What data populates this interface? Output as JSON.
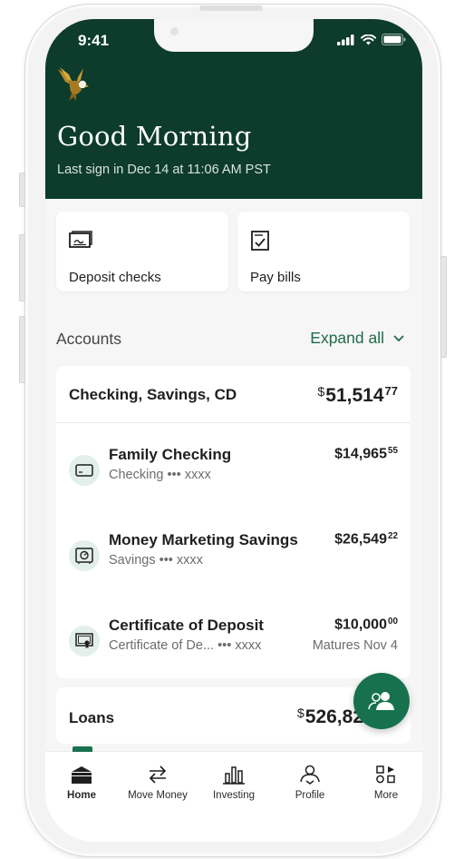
{
  "status_bar": {
    "time": "9:41"
  },
  "header": {
    "greeting": "Good Morning",
    "last_sign_in": "Last sign in Dec 14 at 11:06 AM PST"
  },
  "quick_actions": [
    {
      "label": "Deposit checks",
      "icon": "check-deposit-icon"
    },
    {
      "label": "Pay bills",
      "icon": "bill-icon"
    }
  ],
  "accounts_section": {
    "title": "Accounts",
    "expand_label": "Expand all"
  },
  "account_group": {
    "title": "Checking, Savings, CD",
    "total_whole": "51,514",
    "total_cents": "77",
    "accounts": [
      {
        "name": "Family Checking",
        "subtitle": "Checking ••• xxxx",
        "amount_whole": "$14,965",
        "amount_cents": "55",
        "right_note": "",
        "icon": "card-icon"
      },
      {
        "name": "Money Marketing Savings",
        "subtitle": "Savings ••• xxxx",
        "amount_whole": "$26,549",
        "amount_cents": "22",
        "right_note": "",
        "icon": "safe-icon"
      },
      {
        "name": "Certificate of Deposit",
        "subtitle": "Certificate of De... ••• xxxx",
        "amount_whole": "$10,000",
        "amount_cents": "00",
        "right_note": "Matures Nov 4",
        "icon": "certificate-icon"
      }
    ]
  },
  "loans": {
    "title": "Loans",
    "amount_whole": "526,82"
  },
  "currency_symbol": "$",
  "bottom_nav": [
    {
      "label": "Home",
      "icon": "home-icon",
      "active": true
    },
    {
      "label": "Move Money",
      "icon": "transfer-icon",
      "active": false
    },
    {
      "label": "Investing",
      "icon": "bar-chart-icon",
      "active": false
    },
    {
      "label": "Profile",
      "icon": "profile-icon",
      "active": false
    },
    {
      "label": "More",
      "icon": "grid-icon",
      "active": false
    }
  ],
  "colors": {
    "brand_dark": "#0d3b2c",
    "accent": "#17714e",
    "link": "#1f6b4c"
  }
}
